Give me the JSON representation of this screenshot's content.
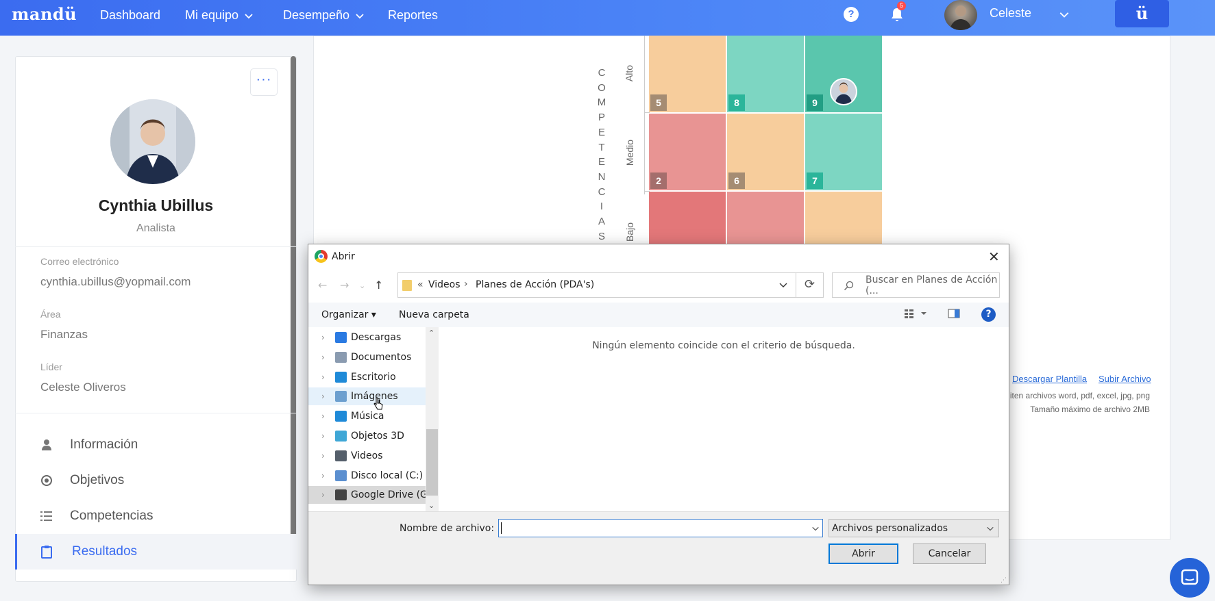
{
  "nav": {
    "logo": "mandü",
    "items": [
      {
        "label": "Dashboard",
        "dropdown": false
      },
      {
        "label": "Mi equipo",
        "dropdown": true
      },
      {
        "label": "Desempeño",
        "dropdown": true
      },
      {
        "label": "Reportes",
        "dropdown": false
      }
    ],
    "help_label": "?",
    "notifications_count": "5",
    "user_name": "Celeste",
    "brand_button": "ü",
    "accent": "#3b6cf0"
  },
  "profile": {
    "name": "Cynthia Ubillus",
    "role": "Analista",
    "more_label": "···",
    "fields": [
      {
        "label": "Correo electrónico",
        "value": "cynthia.ubillus@yopmail.com"
      },
      {
        "label": "Área",
        "value": "Finanzas"
      },
      {
        "label": "Líder",
        "value": "Celeste Oliveros"
      }
    ],
    "menu": [
      {
        "label": "Información",
        "icon": "user-icon",
        "active": false
      },
      {
        "label": "Objetivos",
        "icon": "target-icon",
        "active": false
      },
      {
        "label": "Competencias",
        "icon": "list-icon",
        "active": false
      },
      {
        "label": "Resultados",
        "icon": "clipboard-icon",
        "active": true
      }
    ]
  },
  "matrix": {
    "axis_title_letters": [
      "C",
      "O",
      "M",
      "P",
      "E",
      "T",
      "E",
      "N",
      "C",
      "I",
      "A",
      "S"
    ],
    "levels": [
      "Alto",
      "Medio",
      "Bajo"
    ],
    "cells": [
      {
        "number": "5",
        "color": "#f7cd9c",
        "badge_color": "#a58c73"
      },
      {
        "number": "8",
        "color": "#7dd6c2",
        "badge_color": "#2bb59a"
      },
      {
        "number": "9",
        "color": "#5ac6ad",
        "badge_color": "#229e84",
        "has_avatar": true
      },
      {
        "number": "2",
        "color": "#e89493",
        "badge_color": "#a46e6c"
      },
      {
        "number": "6",
        "color": "#f7cd9c",
        "badge_color": "#a58c73"
      },
      {
        "number": "7",
        "color": "#7dd6c2",
        "badge_color": "#2bb59a"
      },
      {
        "number": "",
        "color": "#e37779"
      },
      {
        "number": "",
        "color": "#e89493"
      },
      {
        "number": "",
        "color": "#f7cd9c"
      }
    ]
  },
  "upload": {
    "download_template": "Descargar Plantilla",
    "upload_file": "Subir Archivo",
    "allowed_note": "iten archivos word, pdf, excel, jpg, png",
    "max_size_note": "Tamaño máximo de archivo 2MB"
  },
  "dialog": {
    "title": "Abrir",
    "close": "✕",
    "address": {
      "prefix": "«",
      "crumbs": [
        "Videos",
        "Planes de Acción (PDA's)"
      ],
      "separator": "›"
    },
    "search_placeholder": "Buscar en Planes de Acción (...",
    "toolbar": {
      "organize": "Organizar",
      "new_folder": "Nueva carpeta",
      "help": "?"
    },
    "tree": [
      {
        "label": "Descargas",
        "icon": "download-icon",
        "color": "#2a7ae2",
        "state": ""
      },
      {
        "label": "Documentos",
        "icon": "documents-icon",
        "color": "#8a9bb0",
        "state": ""
      },
      {
        "label": "Escritorio",
        "icon": "desktop-icon",
        "color": "#1f8ad8",
        "state": ""
      },
      {
        "label": "Imágenes",
        "icon": "pictures-icon",
        "color": "#6c9fcf",
        "state": "hover"
      },
      {
        "label": "Música",
        "icon": "music-icon",
        "color": "#1f8ad8",
        "state": ""
      },
      {
        "label": "Objetos 3D",
        "icon": "objects3d-icon",
        "color": "#3fa7d6",
        "state": ""
      },
      {
        "label": "Videos",
        "icon": "videos-icon",
        "color": "#555f6b",
        "state": ""
      },
      {
        "label": "Disco local (C:)",
        "icon": "drive-icon",
        "color": "#5b8fd0",
        "state": ""
      },
      {
        "label": "Google Drive (G:",
        "icon": "gdrive-icon",
        "color": "#444",
        "state": "selected"
      }
    ],
    "empty_message": "Ningún elemento coincide con el criterio de búsqueda.",
    "filename_label": "Nombre de archivo:",
    "filename_value": "",
    "filetype": "Archivos personalizados",
    "open_button": "Abrir",
    "cancel_button": "Cancelar"
  }
}
